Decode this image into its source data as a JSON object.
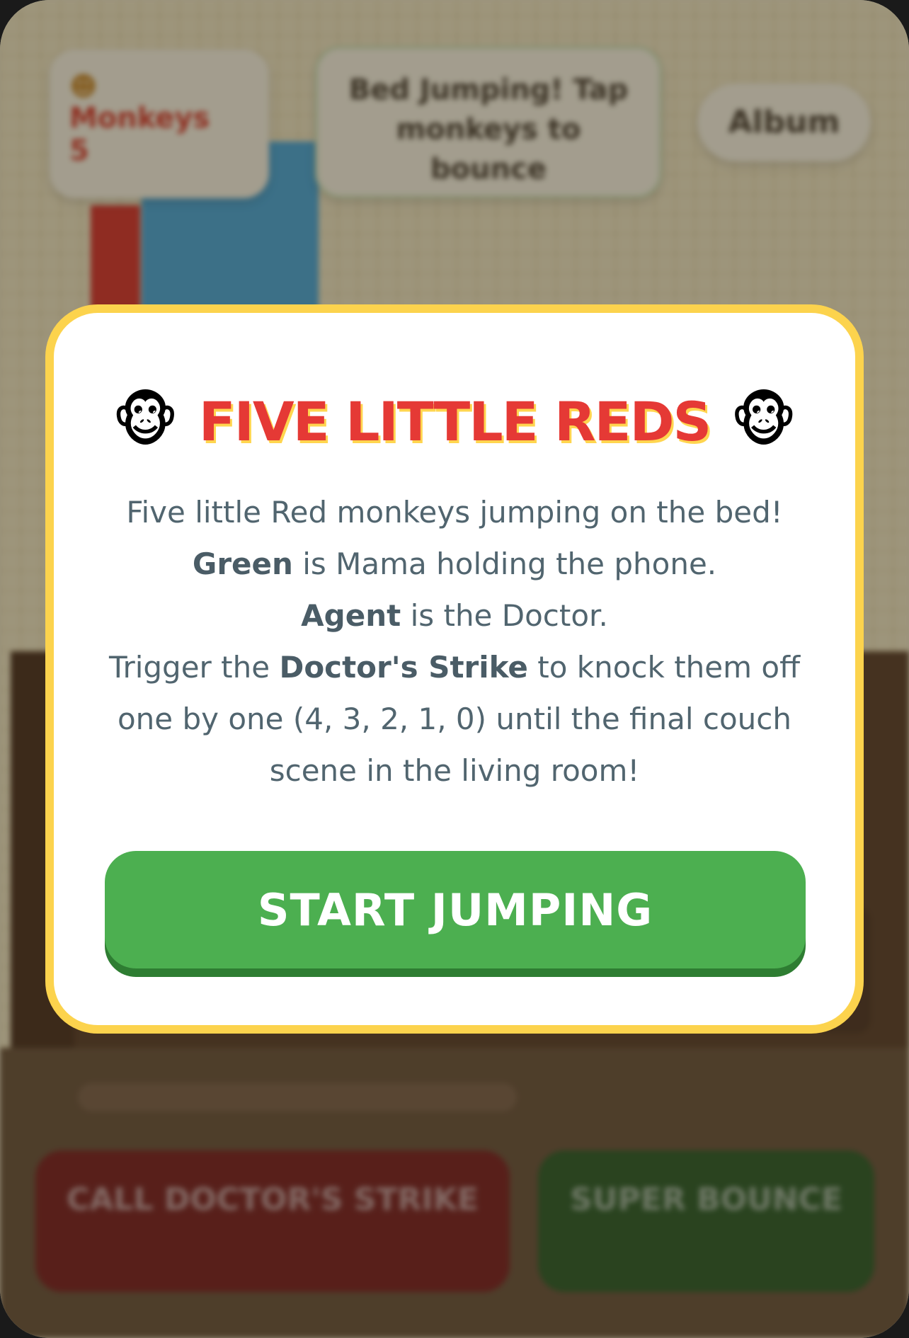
{
  "hud": {
    "monkeys_label": "Monkeys",
    "monkeys_count": "5",
    "status_text": "Bed Jumping! Tap monkeys to bounce",
    "album_label": "Album"
  },
  "controls": {
    "doctor_strike_label": "CALL DOCTOR'S STRIKE",
    "super_bounce_label": "SUPER BOUNCE"
  },
  "modal": {
    "title": "FIVE LITTLE REDS",
    "title_icon_left": "monkey-face-icon",
    "title_icon_right": "monkey-face-icon",
    "line1": "Five little Red monkeys jumping on the bed!",
    "line2_bold": "Green",
    "line2_rest": " is Mama holding the phone.",
    "line3_bold": "Agent",
    "line3_rest": " is the Doctor.",
    "line4_start": "Trigger the ",
    "line4_bold": "Doctor's Strike",
    "line4_end": " to knock them off",
    "line5": "one by one (4, 3, 2, 1, 0) until the final couch",
    "line6": "scene in the living room!",
    "start_button_label": "START JUMPING"
  },
  "colors": {
    "title_red": "#e53935",
    "modal_border": "#fcd34d",
    "start_green": "#4caf50",
    "text_slate": "#51656f"
  }
}
